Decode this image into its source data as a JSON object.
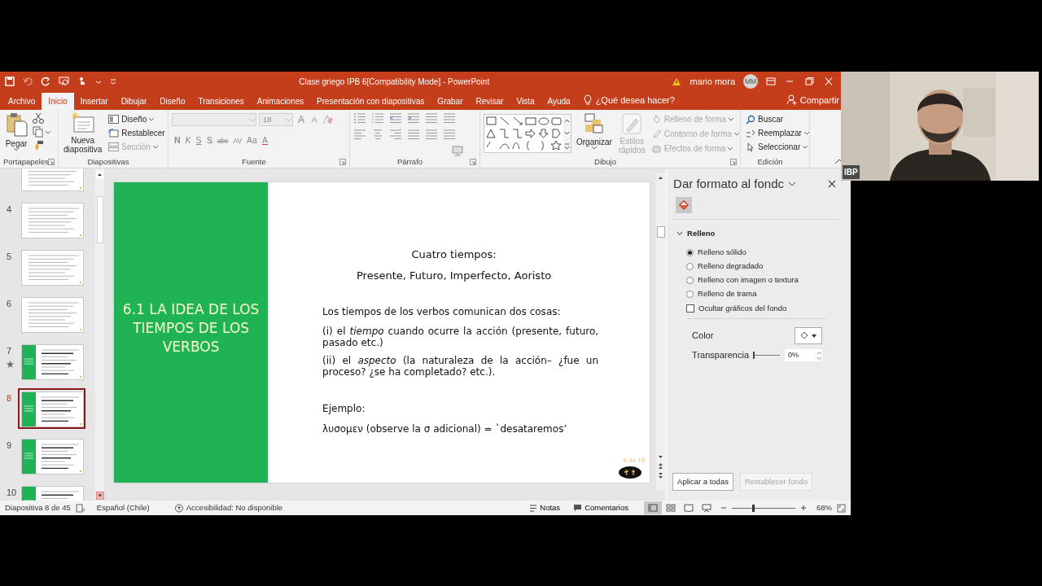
{
  "window": {
    "title": "Clase griego IPB 6[Compatibility Mode]  -  PowerPoint",
    "user": "mario mora",
    "initials": "MM"
  },
  "tabs": [
    {
      "label": "Archivo",
      "selected": false
    },
    {
      "label": "Inicio",
      "selected": true
    },
    {
      "label": "Insertar",
      "selected": false
    },
    {
      "label": "Dibujar",
      "selected": false
    },
    {
      "label": "Diseño",
      "selected": false
    },
    {
      "label": "Transiciones",
      "selected": false
    },
    {
      "label": "Animaciones",
      "selected": false
    },
    {
      "label": "Presentación con diapositivas",
      "selected": false
    },
    {
      "label": "Grabar",
      "selected": false
    },
    {
      "label": "Revisar",
      "selected": false
    },
    {
      "label": "Vista",
      "selected": false
    },
    {
      "label": "Ayuda",
      "selected": false
    }
  ],
  "tell_me": "¿Qué desea hacer?",
  "share": "Compartir",
  "ribbon": {
    "clipboard": {
      "label": "Portapapeles",
      "paste": "Pegar"
    },
    "slides": {
      "label": "Diapositivas",
      "new_slide": "Nueva diapositiva",
      "commands": [
        {
          "label": "Diseño",
          "disabled": false
        },
        {
          "label": "Restablecer",
          "disabled": false
        },
        {
          "label": "Sección",
          "disabled": true
        }
      ]
    },
    "font": {
      "label": "Fuente",
      "size": "18",
      "size_buttons": [
        {
          "label": "A",
          "kind": "grow"
        },
        {
          "label": "A",
          "kind": "shrink"
        }
      ],
      "format_buttons": [
        {
          "label": "N",
          "kind": "bold"
        },
        {
          "label": "K",
          "kind": "italic"
        },
        {
          "label": "S",
          "kind": "underline"
        },
        {
          "label": "S",
          "kind": "shadow"
        },
        {
          "label": "abc",
          "kind": "strike"
        },
        {
          "label": "AV",
          "kind": "spacing"
        },
        {
          "label": "Aa",
          "kind": "case"
        },
        {
          "label": "A",
          "kind": "color"
        }
      ]
    },
    "paragraph": {
      "label": "Párrafo"
    },
    "drawing": {
      "label": "Dibujo",
      "arrange": "Organizar",
      "quick_styles": {
        "label": "Estilos rápidos",
        "disabled": true
      },
      "commands": [
        {
          "label": "Relleno de forma",
          "disabled": true
        },
        {
          "label": "Contorno de forma",
          "disabled": true
        },
        {
          "label": "Efectos de forma",
          "disabled": true
        }
      ]
    },
    "editing": {
      "label": "Edición",
      "commands": [
        "Buscar",
        "Reemplazar",
        "Seleccionar"
      ]
    }
  },
  "thumbnails": [
    {
      "kind": "text",
      "selected": false
    },
    {
      "number": "4",
      "kind": "text",
      "selected": false,
      "starred": false
    },
    {
      "number": "5",
      "kind": "text",
      "selected": false,
      "starred": false
    },
    {
      "number": "6",
      "kind": "text",
      "selected": false,
      "starred": false
    },
    {
      "number": "7",
      "kind": "green",
      "selected": false,
      "starred": true
    },
    {
      "number": "8",
      "kind": "green",
      "selected": true,
      "starred": false
    },
    {
      "number": "9",
      "kind": "green",
      "selected": false,
      "starred": false
    },
    {
      "number": "10",
      "kind": "green",
      "selected": false
    }
  ],
  "slide": {
    "title": "6.1 LA IDEA DE LOS TIEMPOS DE LOS VERBOS",
    "heading": "Cuatro tiempos:",
    "subheading": "Presente, Futuro, Imperfecto, Aoristo",
    "paragraphs": [
      "Los tiempos de los verbos comunican dos cosas:",
      "(i) el *tiempo* cuando ocurre la acción (presente, futuro, pasado etc.)",
      "(ii) el *aspecto* (la naturaleza de la acción– ¿fue un proceso? ¿se ha completado? etc.)."
    ],
    "example_label": "Ejemplo:",
    "example": "λυσομεν (observe la σ adicional) = `desataremos’",
    "page_number": "8 de 19"
  },
  "format_pane": {
    "title": "Dar formato al fondc",
    "section": {
      "label": "Relleno",
      "expanded": true
    },
    "fill_options": [
      {
        "label": "Relleno sólido",
        "selected": true
      },
      {
        "label": "Relleno degradado",
        "selected": false
      },
      {
        "label": "Relleno con imagen o textura",
        "selected": false
      },
      {
        "label": "Relleno de trama",
        "selected": false
      }
    ],
    "hide_background": {
      "label": "Ocultar gráficos del fondo",
      "checked": false
    },
    "color_label": "Color",
    "transparency": {
      "label": "Transparencia",
      "level": 0,
      "value": "0%"
    },
    "buttons": [
      {
        "label": "Aplicar a todas",
        "disabled": false
      },
      {
        "label": "Restablecer fondo",
        "disabled": true
      }
    ]
  },
  "status_bar": {
    "slide": "Diapositiva 8 de 45",
    "language": "Español (Chile)",
    "accessibility": "Accesibilidad: No disponible",
    "notes": "Notas",
    "comments": "Comentarios",
    "views": [
      {
        "selected": true
      },
      {
        "selected": false
      },
      {
        "selected": false
      },
      {
        "selected": false
      }
    ],
    "zoom": {
      "level": 0.33,
      "value": "68%"
    }
  },
  "webcam": {
    "label": "IBP"
  }
}
